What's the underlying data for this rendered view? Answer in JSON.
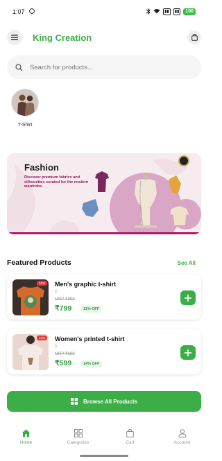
{
  "status": {
    "time": "1:07",
    "battery": "100"
  },
  "app": {
    "title": "King Creation"
  },
  "search": {
    "placeholder": "Search for products..."
  },
  "categories": [
    {
      "label": "T-Shirt"
    }
  ],
  "banner": {
    "title": "Fashion",
    "subtitle": "Discover premium fabrics and silhouettes curated for the modern wardrobe."
  },
  "featured": {
    "title": "Featured Products",
    "see_all": "See All"
  },
  "products": [
    {
      "name": "Men's graphic t-shirt",
      "qty": "1",
      "mrp": "MRP ₹899",
      "price": "₹799",
      "off": "11% OFF",
      "tag": "11%"
    },
    {
      "name": "Women's printed t-shirt",
      "qty": "1",
      "mrp": "MRP ₹699",
      "price": "₹599",
      "off": "14% OFF",
      "tag": "14%"
    }
  ],
  "browse": {
    "label": "Browse All Products"
  },
  "nav": [
    {
      "label": "Home",
      "icon": "home-icon",
      "active": true
    },
    {
      "label": "Categories",
      "icon": "grid-icon",
      "active": false
    },
    {
      "label": "Cart",
      "icon": "bag-icon",
      "active": false
    },
    {
      "label": "Account",
      "icon": "person-icon",
      "active": false
    }
  ],
  "colors": {
    "accent": "#3cae47",
    "banner_bg": "#f6ecef",
    "banner_text": "#9c1460"
  }
}
